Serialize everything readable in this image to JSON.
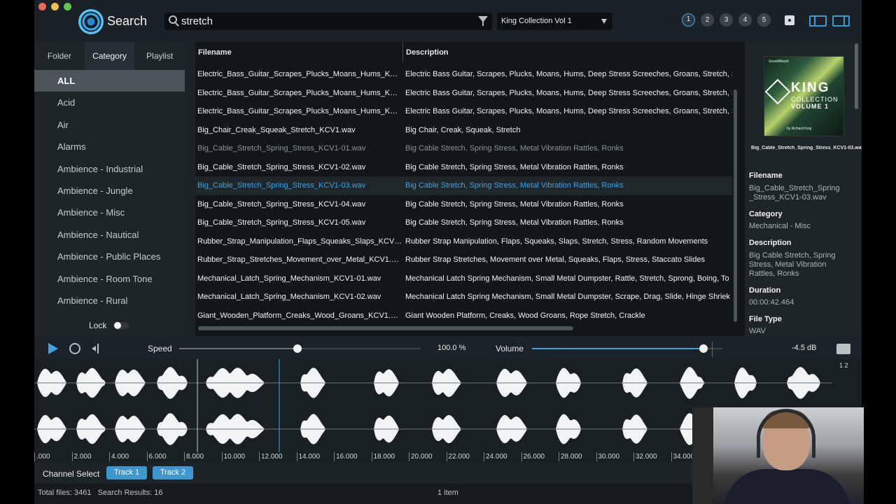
{
  "app": {
    "title": "Search"
  },
  "search": {
    "query": "stretch",
    "collection": "King Collection Vol 1"
  },
  "pages": [
    "1",
    "2",
    "3",
    "4",
    "5"
  ],
  "sidebar": {
    "tabs": [
      "Folder",
      "Category",
      "Playlist"
    ],
    "categories": [
      "ALL",
      "Acid",
      "Air",
      "Alarms",
      "Ambience - Industrial",
      "Ambience - Jungle",
      "Ambience - Misc",
      "Ambience - Nautical",
      "Ambience - Public Places",
      "Ambience - Room Tone",
      "Ambience - Rural"
    ],
    "lock_label": "Lock"
  },
  "table": {
    "headers": [
      "Filename",
      "Description"
    ],
    "rows": [
      {
        "filename": "Electric_Bass_Guitar_Scrapes_Plucks_Moans_Hums_KCV...",
        "description": "Electric Bass Guitar, Scrapes, Plucks, Moans, Hums, Deep Stress Screeches, Groans, Stretch, S"
      },
      {
        "filename": "Electric_Bass_Guitar_Scrapes_Plucks_Moans_Hums_KCV...",
        "description": "Electric Bass Guitar, Scrapes, Plucks, Moans, Hums, Deep Stress Screeches, Groans, Stretch, S"
      },
      {
        "filename": "Electric_Bass_Guitar_Scrapes_Plucks_Moans_Hums_KCV...",
        "description": "Electric Bass Guitar, Scrapes, Plucks, Moans, Hums, Deep Stress Screeches, Groans, Stretch, S"
      },
      {
        "filename": "Big_Chair_Creak_Squeak_Stretch_KCV1.wav",
        "description": "Big Chair, Creak, Squeak, Stretch"
      },
      {
        "filename": "Big_Cable_Stretch_Spring_Stress_KCV1-01.wav",
        "description": "Big Cable Stretch, Spring Stress, Metal Vibration Rattles, Ronks"
      },
      {
        "filename": "Big_Cable_Stretch_Spring_Stress_KCV1-02.wav",
        "description": "Big Cable Stretch, Spring Stress, Metal Vibration Rattles, Ronks"
      },
      {
        "filename": "Big_Cable_Stretch_Spring_Stress_KCV1-03.wav",
        "description": "Big Cable Stretch, Spring Stress, Metal Vibration Rattles, Ronks"
      },
      {
        "filename": "Big_Cable_Stretch_Spring_Stress_KCV1-04.wav",
        "description": "Big Cable Stretch, Spring Stress, Metal Vibration Rattles, Ronks"
      },
      {
        "filename": "Big_Cable_Stretch_Spring_Stress_KCV1-05.wav",
        "description": "Big Cable Stretch, Spring Stress, Metal Vibration Rattles, Ronks"
      },
      {
        "filename": "Rubber_Strap_Manipulation_Flaps_Squeaks_Slaps_KCV1....",
        "description": "Rubber Strap Manipulation, Flaps, Squeaks, Slaps, Stretch, Stress, Random Movements"
      },
      {
        "filename": "Rubber_Strap_Stretches_Movement_over_Metal_KCV1.wav",
        "description": "Rubber Strap Stretches, Movement over Metal, Squeaks, Flaps, Stress, Staccato Slides"
      },
      {
        "filename": "Mechanical_Latch_Spring_Mechanism_KCV1-01.wav",
        "description": "Mechanical Latch Spring Mechanism, Small Metal Dumpster, Rattle, Stretch, Sprong, Boing, To"
      },
      {
        "filename": "Mechanical_Latch_Spring_Mechanism_KCV1-02.wav",
        "description": "Mechanical Latch Spring Mechanism, Small Metal Dumpster, Scrape, Drag, Slide, Hinge Shriek"
      },
      {
        "filename": "Giant_Wooden_Platform_Creaks_Wood_Groans_KCV1.wav",
        "description": "Giant Wooden Platform, Creaks, Wood Groans, Rope Stretch, Crackle"
      }
    ]
  },
  "detail": {
    "cover": {
      "brand": "SoundMorph",
      "title1": "KING",
      "title2": "COLLECTION",
      "title3": "VOLUME 1",
      "byline": "by Richard King"
    },
    "caption": "Big_Cable_Stretch_Spring_Stress_KCV1-03.wav",
    "filename_label": "Filename",
    "filename": "Big_Cable_Stretch_Spring_Stress_KCV1-03.wav",
    "category_label": "Category",
    "category": "Mechanical - Misc",
    "description_label": "Description",
    "description": "Big Cable Stretch, Spring Stress, Metal Vibration Rattles, Ronks",
    "duration_label": "Duration",
    "duration": "00:00:42.464",
    "filetype_label": "File Type",
    "filetype": "WAV"
  },
  "transport": {
    "speed_label": "Speed",
    "speed_value": "100.0 %",
    "speed_fraction": 0.49,
    "volume_label": "Volume",
    "volume_value": "-4.5 dB",
    "volume_fraction": 0.9
  },
  "waveform": {
    "ticks": [
      ".000",
      "|2.000",
      "|4.000",
      "|6.000",
      "|8.000",
      "|10.000",
      "|12.000",
      "|14.000",
      "|16.000",
      "|18.000",
      "|20.000",
      "|22.000",
      "|24.000",
      "|26.000",
      "|28.000",
      "|30.000",
      "|32.000",
      "|34.000"
    ],
    "channel_labels": "1 2"
  },
  "channel_select": {
    "label": "Channel Select",
    "tracks": [
      "Track 1",
      "Track 2"
    ]
  },
  "status": {
    "left": "Total files: 3461   Search Results: 16",
    "center": "1 item"
  },
  "colors": {
    "accent": "#3ea3e6",
    "background": "#1b2328"
  }
}
